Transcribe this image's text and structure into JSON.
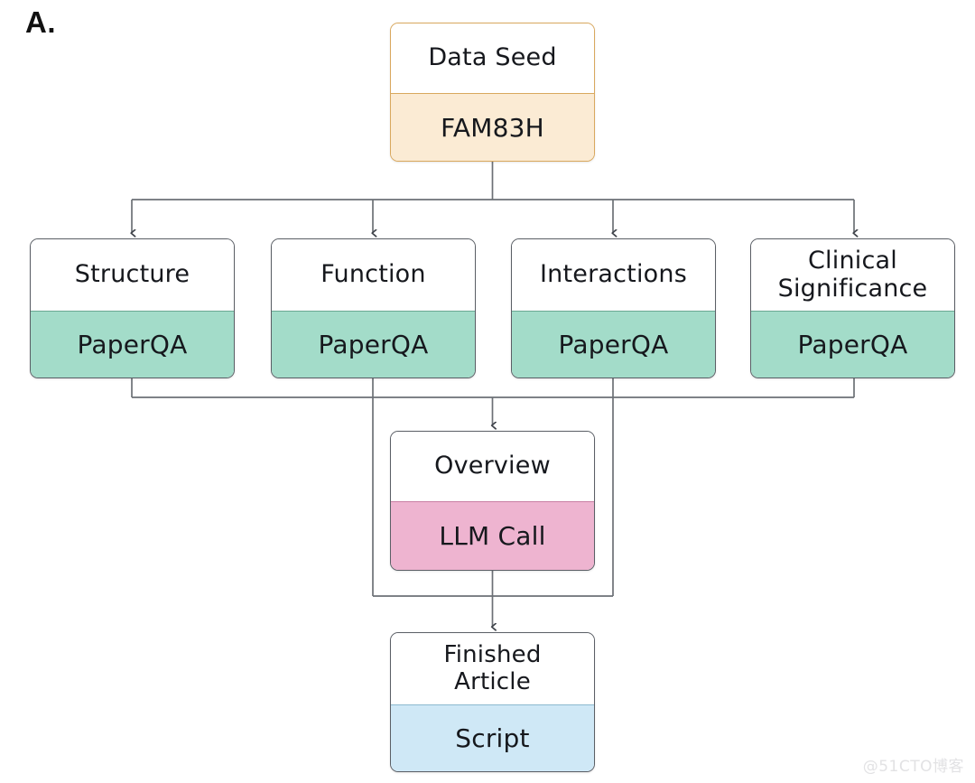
{
  "figure": {
    "panel_label": "A.",
    "watermark": "@51CTO博客",
    "line_color": "#5b5f66"
  },
  "nodes": {
    "seed": {
      "title": "Data Seed",
      "body": "FAM83H",
      "fill": "#fbebd4",
      "stroke": "#d9a85e"
    },
    "structure": {
      "title": "Structure",
      "body": "PaperQA",
      "fill": "#a3dcc9",
      "stroke": "#6aa893"
    },
    "function": {
      "title": "Function",
      "body": "PaperQA",
      "fill": "#a3dcc9",
      "stroke": "#6aa893"
    },
    "interactions": {
      "title": "Interactions",
      "body": "PaperQA",
      "fill": "#a3dcc9",
      "stroke": "#6aa893"
    },
    "clinical": {
      "title": "Clinical\nSignificance",
      "body": "PaperQA",
      "fill": "#a3dcc9",
      "stroke": "#6aa893"
    },
    "overview": {
      "title": "Overview",
      "body": "LLM Call",
      "fill": "#eeb4d0",
      "stroke": "#c87fa4"
    },
    "finished": {
      "title": "Finished\nArticle",
      "body": "Script",
      "fill": "#cfe8f6",
      "stroke": "#8cb9cf"
    }
  }
}
